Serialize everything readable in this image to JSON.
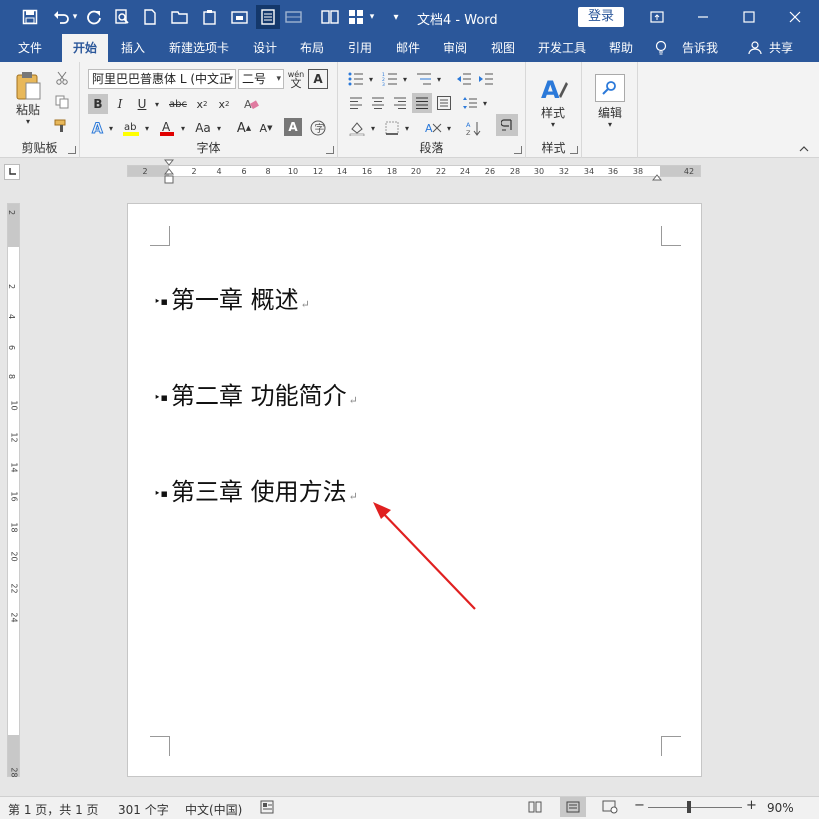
{
  "titlebar": {
    "doc_title": "文档4 - Word",
    "login_label": "登录"
  },
  "tabs": [
    {
      "label": "文件"
    },
    {
      "label": "开始"
    },
    {
      "label": "插入"
    },
    {
      "label": "新建选项卡"
    },
    {
      "label": "设计"
    },
    {
      "label": "布局"
    },
    {
      "label": "引用"
    },
    {
      "label": "邮件"
    },
    {
      "label": "审阅"
    },
    {
      "label": "视图"
    },
    {
      "label": "开发工具"
    },
    {
      "label": "帮助"
    },
    {
      "label": "告诉我"
    },
    {
      "label": "共享"
    }
  ],
  "ribbon": {
    "clipboard": {
      "label": "剪贴板",
      "paste": "粘贴"
    },
    "font": {
      "label": "字体",
      "font_name": "阿里巴巴普惠体 L (中文正",
      "font_size": "二号",
      "wen": "wén",
      "wen_char": "文"
    },
    "paragraph": {
      "label": "段落"
    },
    "styles": {
      "label": "样式",
      "styles_btn": "样式"
    },
    "editing": {
      "editing_btn": "编辑"
    }
  },
  "ruler": {
    "h_ticks": [
      "2",
      "2",
      "4",
      "6",
      "8",
      "10",
      "12",
      "14",
      "16",
      "18",
      "20",
      "22",
      "24",
      "26",
      "28",
      "30",
      "32",
      "34",
      "36",
      "38",
      "42"
    ],
    "v_ticks": [
      "2",
      "2",
      "4",
      "6",
      "8",
      "10",
      "12",
      "14",
      "16",
      "18",
      "20",
      "22",
      "24",
      "28"
    ]
  },
  "document": {
    "headings": [
      {
        "text": "第一章 概述"
      },
      {
        "text": "第二章 功能简介"
      },
      {
        "text": "第三章 使用方法"
      }
    ]
  },
  "statusbar": {
    "page_info": "第 1 页，共 1 页",
    "word_count": "301 个字",
    "language": "中文(中国)",
    "zoom": "90%"
  },
  "colors": {
    "brand": "#2b579a",
    "arrow": "#e02020"
  }
}
